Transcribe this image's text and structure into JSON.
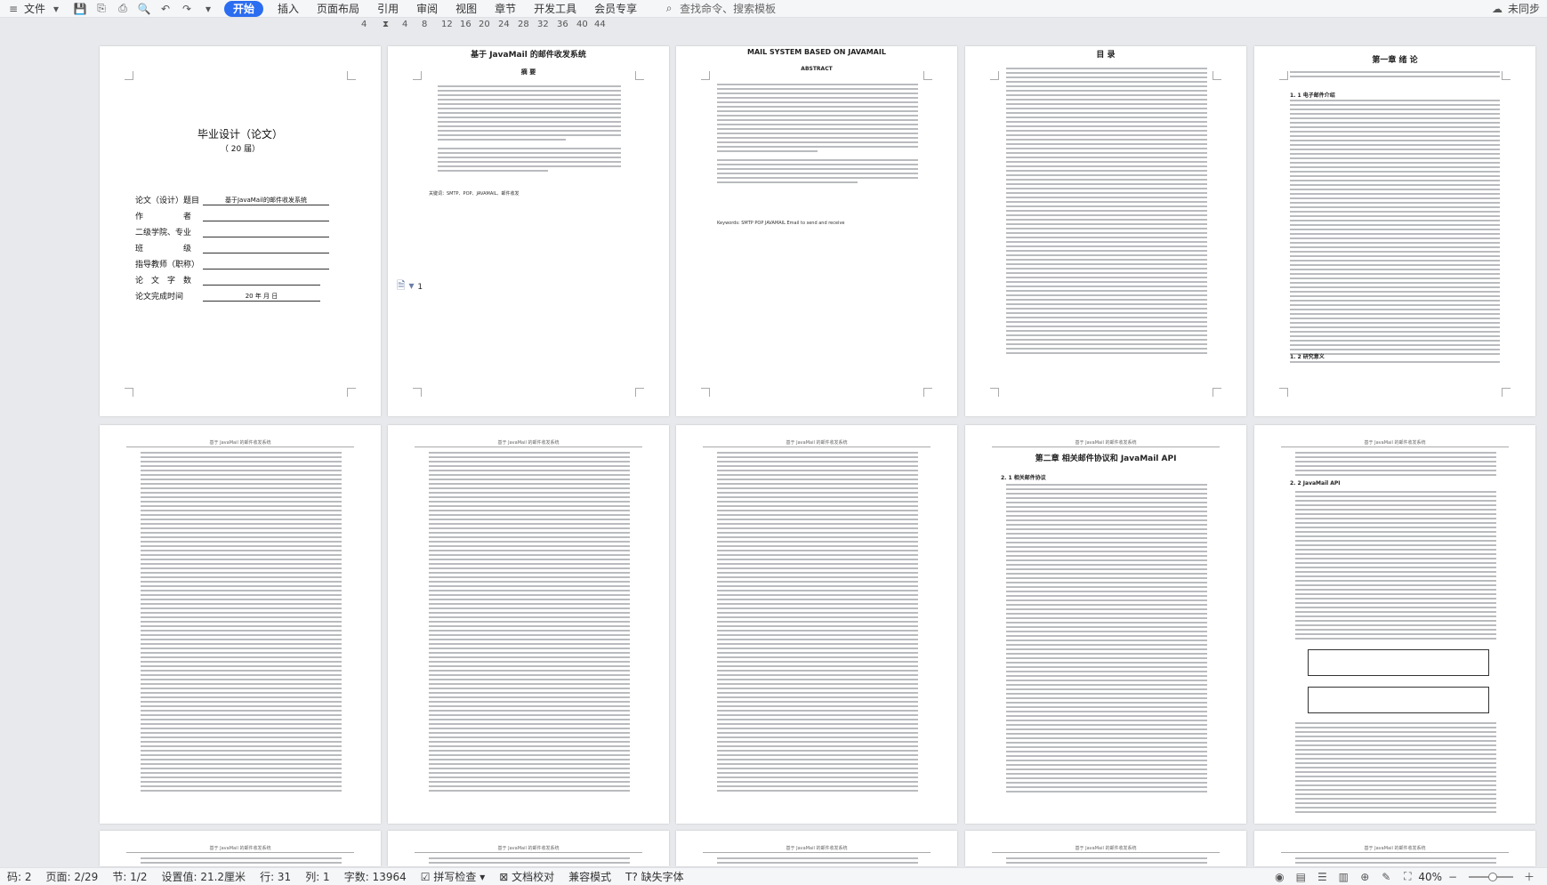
{
  "toolbar": {
    "file_menu": "文件",
    "tabs": [
      "开始",
      "插入",
      "页面布局",
      "引用",
      "审阅",
      "视图",
      "章节",
      "开发工具",
      "会员专享"
    ],
    "active_tab": "开始",
    "search_placeholder": "查找命令、搜索模板",
    "sync_label": "未同步",
    "icons": [
      "save-icon",
      "export-icon",
      "print-icon",
      "preview-icon",
      "undo-icon",
      "redo-icon",
      "more-icon"
    ]
  },
  "ruler": {
    "ticks": [
      "4",
      "4",
      "8",
      "12",
      "16",
      "20",
      "24",
      "28",
      "32",
      "36",
      "40",
      "44"
    ]
  },
  "pages": {
    "cover": {
      "title": "毕业设计（论文）",
      "year": "（ 20 届）",
      "rows": [
        {
          "label": "论文（设计）题目",
          "value": "基于JavaMail的邮件收发系统"
        },
        {
          "label": "作　　　　　者",
          "value": ""
        },
        {
          "label": "二级学院、专业",
          "value": ""
        },
        {
          "label": "班　　　　　级",
          "value": ""
        },
        {
          "label": "指导教师（职称）",
          "value": ""
        },
        {
          "label": "论　文　字　数",
          "value": ""
        },
        {
          "label": "论文完成时间",
          "value": "20 年 月 日"
        }
      ]
    },
    "abstract_cn": {
      "title": "基于 JavaMail 的邮件收发系统",
      "subtitle": "摘 要",
      "keywords": "关键词：SMTP、POP、JAVAMAIL、邮件收发"
    },
    "abstract_en": {
      "title": "MAIL SYSTEM BASED ON JAVAMAIL",
      "subtitle": "ABSTRACT",
      "keywords": "Keywords: SMTP POP JAVAMAIL Email to send and receive"
    },
    "toc": {
      "title": "目 录"
    },
    "chapter1": {
      "title": "第一章 绪 论",
      "sec1": "1. 1 电子邮件介绍",
      "sec2": "1. 2 研究意义"
    },
    "chapter2": {
      "title": "第二章 相关邮件协议和 JavaMail API",
      "sec1": "2. 1 相关邮件协议",
      "sec2": "2. 2 JavaMail API"
    },
    "page_header": "基于 JavaMail 的邮件收发系统"
  },
  "statusbar": {
    "page_code": "码: 2",
    "page": "页面: 2/29",
    "section": "节: 1/2",
    "setting": "设置值: 21.2厘米",
    "row": "行: 31",
    "col": "列: 1",
    "words": "字数: 13964",
    "spell": "拼写检查",
    "proof": "文档校对",
    "compat": "兼容模式",
    "missing_font": "缺失字体",
    "zoom": "40%"
  }
}
